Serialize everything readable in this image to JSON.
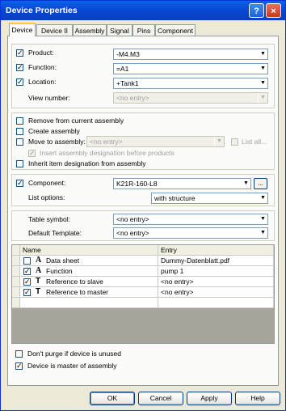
{
  "window": {
    "title": "Device Properties",
    "help_glyph": "?",
    "close_glyph": "×"
  },
  "tabs": [
    "Device",
    "Device II",
    "Assembly",
    "Signal",
    "Pins",
    "Component"
  ],
  "device": {
    "product": {
      "checked": true,
      "label": "Product:",
      "value": "-M4.M3"
    },
    "function": {
      "checked": true,
      "label": "Function:",
      "value": "=A1"
    },
    "location": {
      "checked": true,
      "label": "Location:",
      "value": "+Tank1"
    },
    "view_number": {
      "label": "View number:",
      "value": "<no entry>"
    }
  },
  "assembly": {
    "remove_label": "Remove from current assembly",
    "create_label": "Create assembly",
    "move_label": "Move to assembly:",
    "move_value": "<no entry>",
    "list_all_label": "List all...",
    "insert_label": "Insert assembly designation before products",
    "inherit_label": "Inherit item designation from assembly"
  },
  "component": {
    "checked": true,
    "label": "Component:",
    "value": "K21R-160-L8",
    "ellipsis": "...",
    "list_options_label": "List options:",
    "list_options_value": "with structure"
  },
  "symbols": {
    "table_symbol_label": "Table symbol:",
    "table_symbol_value": "<no entry>",
    "default_template_label": "Default Template:",
    "default_template_value": "<no entry>"
  },
  "attributes": {
    "columns": [
      "Name",
      "Entry"
    ],
    "rows": [
      {
        "checked": false,
        "type": "A",
        "name": "Data sheet",
        "entry": "Dummy-Datenblatt.pdf"
      },
      {
        "checked": true,
        "type": "A",
        "name": "Function",
        "entry": "pump 1"
      },
      {
        "checked": true,
        "type": "T",
        "name": "Reference to slave",
        "entry": "<no entry>"
      },
      {
        "checked": true,
        "type": "T",
        "name": "Reference to master",
        "entry": "<no entry>"
      }
    ]
  },
  "footer_options": {
    "dont_purge_label": "Don't purge if device is unused",
    "dont_purge_checked": false,
    "master_label": "Device is master of assembly",
    "master_checked": true
  },
  "buttons": {
    "ok": "OK",
    "cancel": "Cancel",
    "apply": "Apply",
    "help": "Help"
  }
}
